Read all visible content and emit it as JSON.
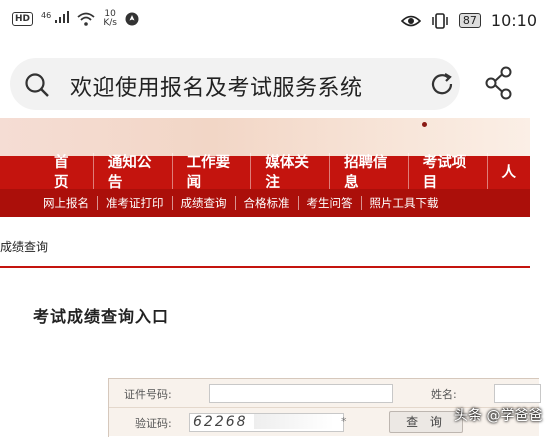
{
  "status_bar": {
    "hd": "HD",
    "network": "46",
    "speed_value": "10",
    "speed_unit": "K/s",
    "battery": "87",
    "time": "10:10"
  },
  "browser": {
    "search_text": "欢迎使用报名及考试服务系统"
  },
  "nav": {
    "main_items": [
      "首页",
      "通知公告",
      "工作要闻",
      "媒体关注",
      "招聘信息",
      "考试项目",
      "人"
    ],
    "sub_items": [
      "网上报名",
      "准考证打印",
      "成绩查询",
      "合格标准",
      "考生问答",
      "照片工具下载"
    ]
  },
  "breadcrumb": "成绩查询",
  "page_title": "考试成绩查询入口",
  "form": {
    "id_label": "证件号码:",
    "name_label": "姓名:",
    "captcha_label": "验证码:",
    "captcha_value": "62268",
    "required_mark": "*",
    "query_button": "查 询"
  },
  "watermark": "头条 @学爸爸"
}
